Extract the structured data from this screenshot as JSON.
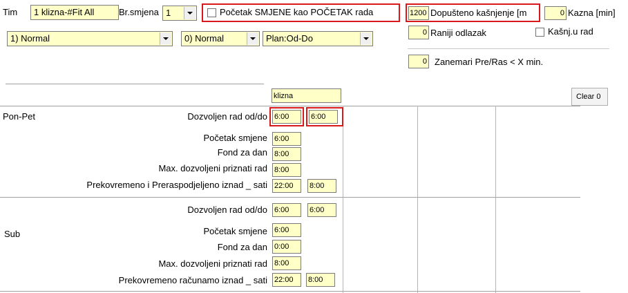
{
  "header": {
    "tim_label": "Tim",
    "tim_value": "1 klizna-#Fit All",
    "br_smjena_label": "Br.smjena",
    "br_smjena_value": "1",
    "pocetak_checkbox_label": "Početak SMJENE kao POČETAK rada",
    "dopusteno_value": "1200",
    "dopusteno_label": "Dopušteno kašnjenje [m",
    "kazna_value": "0",
    "kazna_label": "Kazna [min]",
    "raniji_value": "0",
    "raniji_label": "Raniji odlazak",
    "kasnj_label": "Kašnj.u rad",
    "zanemari_value": "0",
    "zanemari_label": "Zanemari Pre/Ras < X min.",
    "combo1_value": "1) Normal",
    "combo2_value": "0) Normal",
    "combo3_value": "Plan:Od-Do"
  },
  "grid": {
    "column_header": "klizna",
    "clear_button": "Clear 0",
    "groups": [
      {
        "name": "Pon-Pet",
        "rows": [
          {
            "label": "Dozvoljen rad od/do",
            "v1": "6:00",
            "v2": "6:00"
          },
          {
            "label": "Početak smjene",
            "v1": "6:00"
          },
          {
            "label": "Fond za dan",
            "v1": "8:00"
          },
          {
            "label": "Max. dozvoljeni priznati rad",
            "v1": "8:00"
          },
          {
            "label": "Prekovremeno i Preraspodjeljeno iznad _ sati",
            "v1": "22:00",
            "v2": "8:00"
          }
        ]
      },
      {
        "name": "Sub",
        "rows": [
          {
            "label": "Dozvoljen rad od/do",
            "v1": "6:00",
            "v2": "6:00"
          },
          {
            "label": "Početak smjene",
            "v1": "6:00"
          },
          {
            "label": "Fond za dan",
            "v1": "0:00"
          },
          {
            "label": "Max. dozvoljeni priznati rad",
            "v1": "8:00"
          },
          {
            "label": "Prekovremeno računamo iznad _ sati",
            "v1": "22:00",
            "v2": "8:00"
          }
        ]
      }
    ]
  },
  "colors": {
    "field_bg": "#ffffc8",
    "highlight": "#d8191c"
  }
}
